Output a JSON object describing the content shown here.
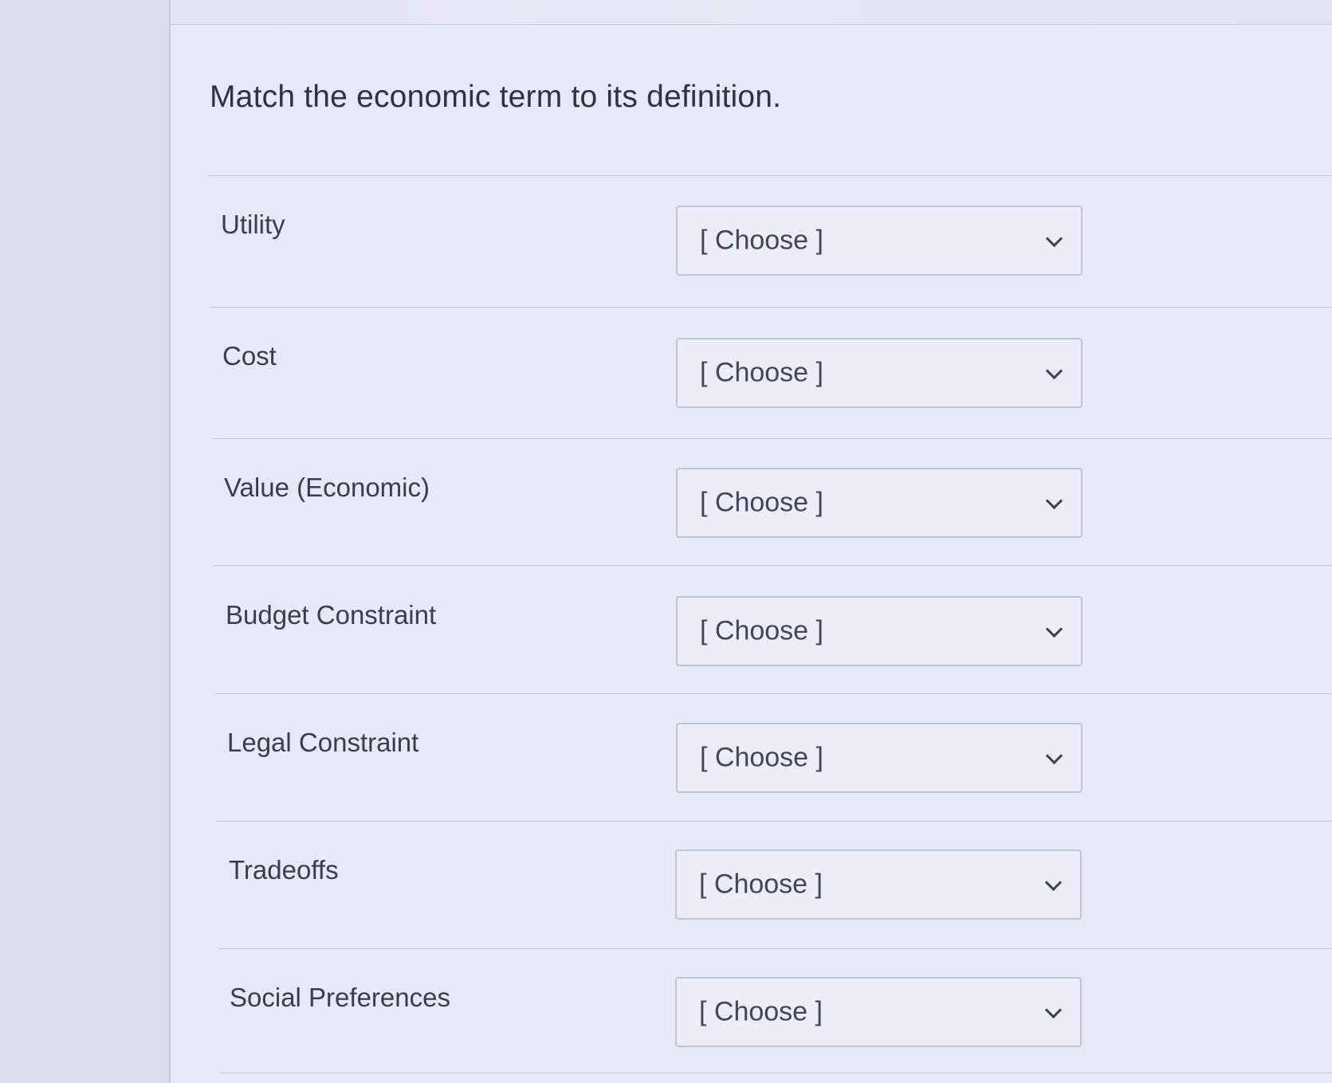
{
  "question": {
    "prompt": "Match the economic term to its definition."
  },
  "rows": [
    {
      "term": "Utility",
      "selected": "[ Choose ]"
    },
    {
      "term": "Cost",
      "selected": "[ Choose ]"
    },
    {
      "term": "Value (Economic)",
      "selected": "[ Choose ]"
    },
    {
      "term": "Budget Constraint",
      "selected": "[ Choose ]"
    },
    {
      "term": "Legal Constraint",
      "selected": "[ Choose ]"
    },
    {
      "term": "Tradeoffs",
      "selected": "[ Choose ]"
    },
    {
      "term": "Social Preferences",
      "selected": "[ Choose ]"
    }
  ]
}
